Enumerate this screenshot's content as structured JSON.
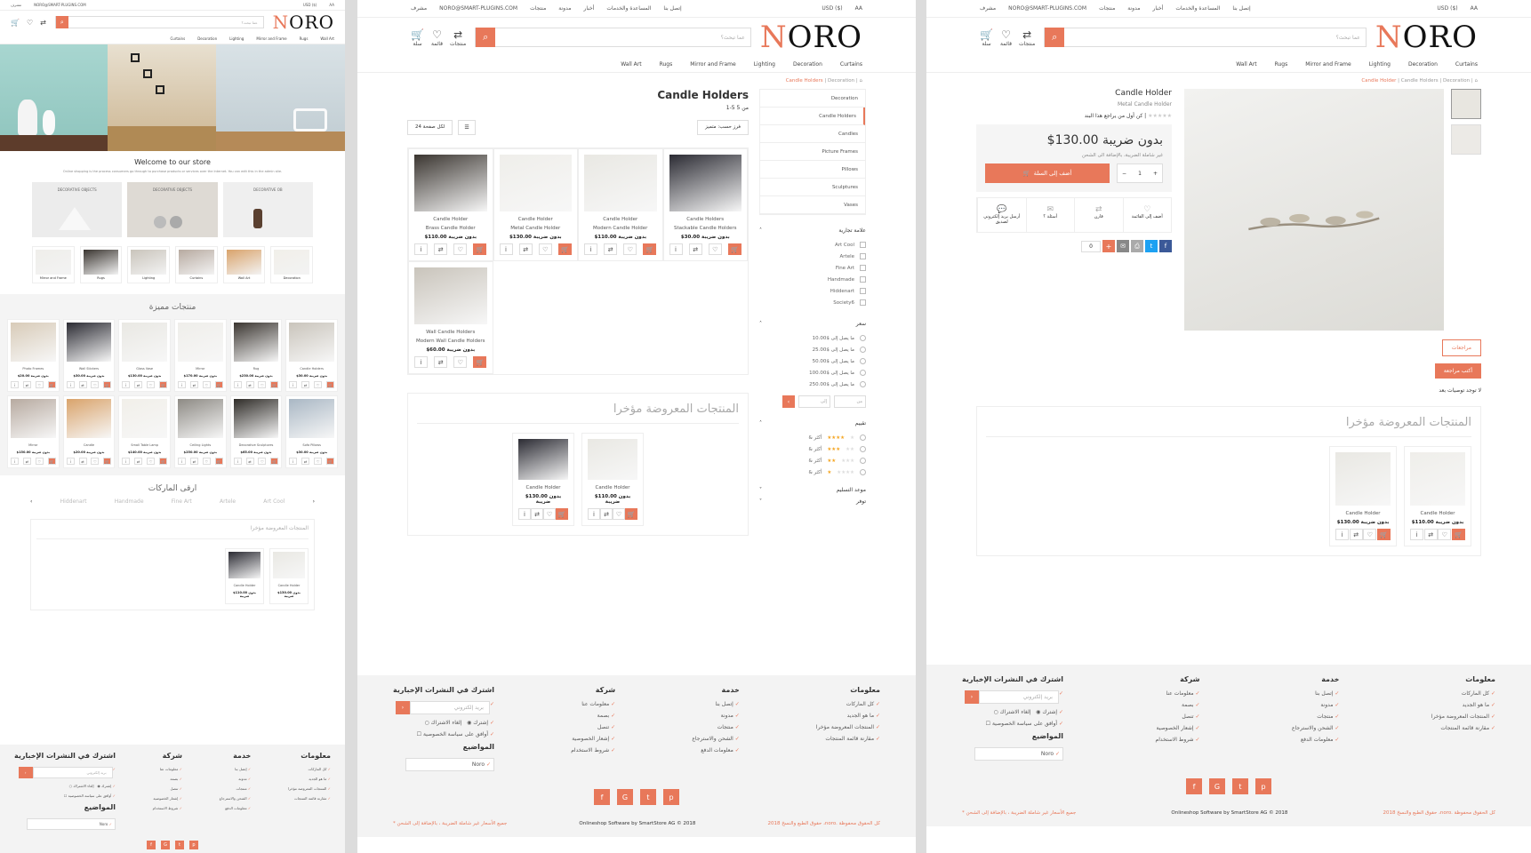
{
  "common": {
    "logo": "NORO",
    "top_links": [
      "إتصل بنا",
      "المساعدة والخدمات",
      "أخبار",
      "مدونة",
      "منتجات"
    ],
    "email": "NORO@SMART-PLUGINS.COM",
    "admin": "مشرف",
    "currency": "USD ($)",
    "lang": "AA",
    "search_placeholder": "عما تبحث؟",
    "header_icons": [
      {
        "label": "سلة",
        "icon": "cart-icon"
      },
      {
        "label": "قائمة",
        "icon": "heart-icon"
      },
      {
        "label": "منتجات",
        "icon": "compare-icon"
      }
    ],
    "menu": [
      "Curtains",
      "Decoration",
      "Lighting",
      "Mirror and Frame",
      "Rugs",
      "Wall Art"
    ],
    "footer": {
      "info_title": "معلومات",
      "info_items": [
        "كل الماركات",
        "ما هو الجديد",
        "المنتجات المعروضة مؤخرا",
        "مقارنة قائمة المنتجات"
      ],
      "service_title": "خدمة",
      "service_items": [
        "إتصل بنا",
        "مدونة",
        "منتجات",
        "الشحن والاسترجاع",
        "معلومات الدفع"
      ],
      "company_title": "شركة",
      "company_items": [
        "معلومات عنا",
        "بصمة",
        "تنصل",
        "إشعار الخصوصية",
        "شروط الاستخدام"
      ],
      "news_title": "اشترك في النشرات الإخبارية",
      "news_placeholder": "بريد إلكتروني",
      "subscribe": "إشترك",
      "unsubscribe": "إلغاء الاشتراك",
      "privacy": "أوافق على سياسة الخصوصية",
      "topics_title": "المواضيع",
      "topics_value": "Noro",
      "copyright": "حقوق الطبع والنسخ 2018 ،noro. كل الحقوق محفوظة",
      "powered": "Onlineshop Software by SmartStore AG © 2018",
      "tax_note": "* جميع الأسعار غير شاملة الضريبة ، بالإضافة إلى الشحن"
    },
    "recent_title": "المنتجات المعروضة مؤخرا"
  },
  "home": {
    "welcome": "Welcome to our store",
    "intro": "Online shopping is the process consumers go through to purchase products or services over the Internet. You can edit this in the admin site.",
    "deco_labels": [
      "DECORATIVE OBJECTS",
      "DECORATIVE OBJECTS",
      "DECORATIVE OB"
    ],
    "categories": [
      "Mirror and Frame",
      "Rugs",
      "Lighting",
      "Curtains",
      "Wall Art",
      "Decoration"
    ],
    "featured_title": "منتجات مميزة",
    "featured": [
      {
        "name": "Photo Frames",
        "price": "$20.00 بدون ضريبة"
      },
      {
        "name": "Wall Stickers",
        "price": "$30.00 بدون ضريبة"
      },
      {
        "name": "Glass Vase",
        "price": "$130.00 بدون ضريبة"
      },
      {
        "name": "Mirror",
        "price": "$170.00 بدون ضريبة"
      },
      {
        "name": "Rug",
        "price": "$230.00 بدون ضريبة"
      },
      {
        "name": "Candle Holders",
        "price": "$30.00 بدون ضريبة"
      },
      {
        "name": "Mirror",
        "price": "$150.00 بدون ضريبة"
      },
      {
        "name": "Candle",
        "price": "$20.00 بدون ضريبة"
      },
      {
        "name": "Small Table Lamp",
        "price": "$140.00 بدون ضريبة"
      },
      {
        "name": "Ceiling Lights",
        "price": "$250.00 بدون ضريبة"
      },
      {
        "name": "Decorative Sculptures",
        "price": "$65.00 بدون ضريبة"
      },
      {
        "name": "Sofa Pillows",
        "price": "$30.00 بدون ضريبة"
      }
    ],
    "brands_title": "ارقى الماركات",
    "brands": [
      "Hiddenart",
      "Handmade",
      "Fine Art",
      "Artele",
      "Art Cool"
    ],
    "recent": [
      {
        "name": "Candle Holder",
        "price": "$110.00 بدون ضريبة"
      },
      {
        "name": "Candle Holder",
        "price": "$130.00 بدون ضريبة"
      }
    ]
  },
  "category": {
    "crumbs": [
      "Decoration",
      "Candle Holders"
    ],
    "title": "Candle Holders",
    "count": "1-5 من 5",
    "sort": "فرز حسب: متميز",
    "per_page": "24 لكل صفحة",
    "products": [
      {
        "cat": "Candle Holders",
        "name": "Stackable Candle Holders",
        "price": "$30.00 بدون ضريبة"
      },
      {
        "cat": "Candle Holder",
        "name": "Modern Candle Holder",
        "price": "$110.00 بدون ضريبة"
      },
      {
        "cat": "Candle Holder",
        "name": "Metal Candle Holder",
        "price": "$130.00 بدون ضريبة"
      },
      {
        "cat": "Candle Holder",
        "name": "Brass Candle Holder",
        "price": "$110.00 بدون ضريبة"
      },
      {
        "cat": "Wall Candle Holders",
        "name": "Modern Wall Candle Holders",
        "price": "$60.00 بدون ضريبة"
      }
    ],
    "side_nav": [
      "Decoration",
      "Candle Holders",
      "Candles",
      "Picture Frames",
      "Pillows",
      "Sculptures",
      "Vases"
    ],
    "brand_title": "علامة تجارية",
    "brands": [
      "Art Cool",
      "Artele",
      "Fine Art",
      "Handmade",
      "Hiddenart",
      "Society6"
    ],
    "price_title": "سعر",
    "prices": [
      "ما يصل إلى $10.00",
      "ما يصل إلى $25.00",
      "ما يصل إلى $50.00",
      "ما يصل إلى $100.00",
      "ما يصل إلى $250.00"
    ],
    "price_from": "من",
    "price_to": "إلى",
    "rating_title": "تقييم",
    "ratings": [
      "& أكثر",
      "& أكثر",
      "& أكثر",
      "& أكثر"
    ],
    "delivery_title": "موعد التسليم",
    "availability_title": "توفر",
    "recent": [
      {
        "name": "Candle Holder",
        "price": "$130.00 بدون ضريبة"
      },
      {
        "name": "Candle Holder",
        "price": "$110.00 بدون ضريبة"
      }
    ]
  },
  "product": {
    "crumbs": [
      "Decoration",
      "Candle Holders",
      "Candle Holder"
    ],
    "title": "Candle Holder",
    "subtitle": "Metal Candle Holder",
    "review_prompt": "كن أول من يراجع هذا البند",
    "price": "$130.00 بدون ضريبة",
    "tax_note": "غير شاملة الضريبة، بالإضافة الى الشحن",
    "qty": "1",
    "add_to_cart": "أضف إلى السلة",
    "actions": [
      "أضف إلى القائمة",
      "قارن",
      "أسئلة ؟",
      "أرسل بريد إلكتروني لصديق"
    ],
    "share_count": "0",
    "reviews_tab": "مراجعات",
    "write_review": "أكتب مراجعة",
    "no_reviews": "لا توجد توصيات بعد",
    "recent": [
      {
        "name": "Candle Holder",
        "price": "$130.00 بدون ضريبة"
      },
      {
        "name": "Candle Holder",
        "price": "$110.00 بدون ضريبة"
      }
    ]
  }
}
